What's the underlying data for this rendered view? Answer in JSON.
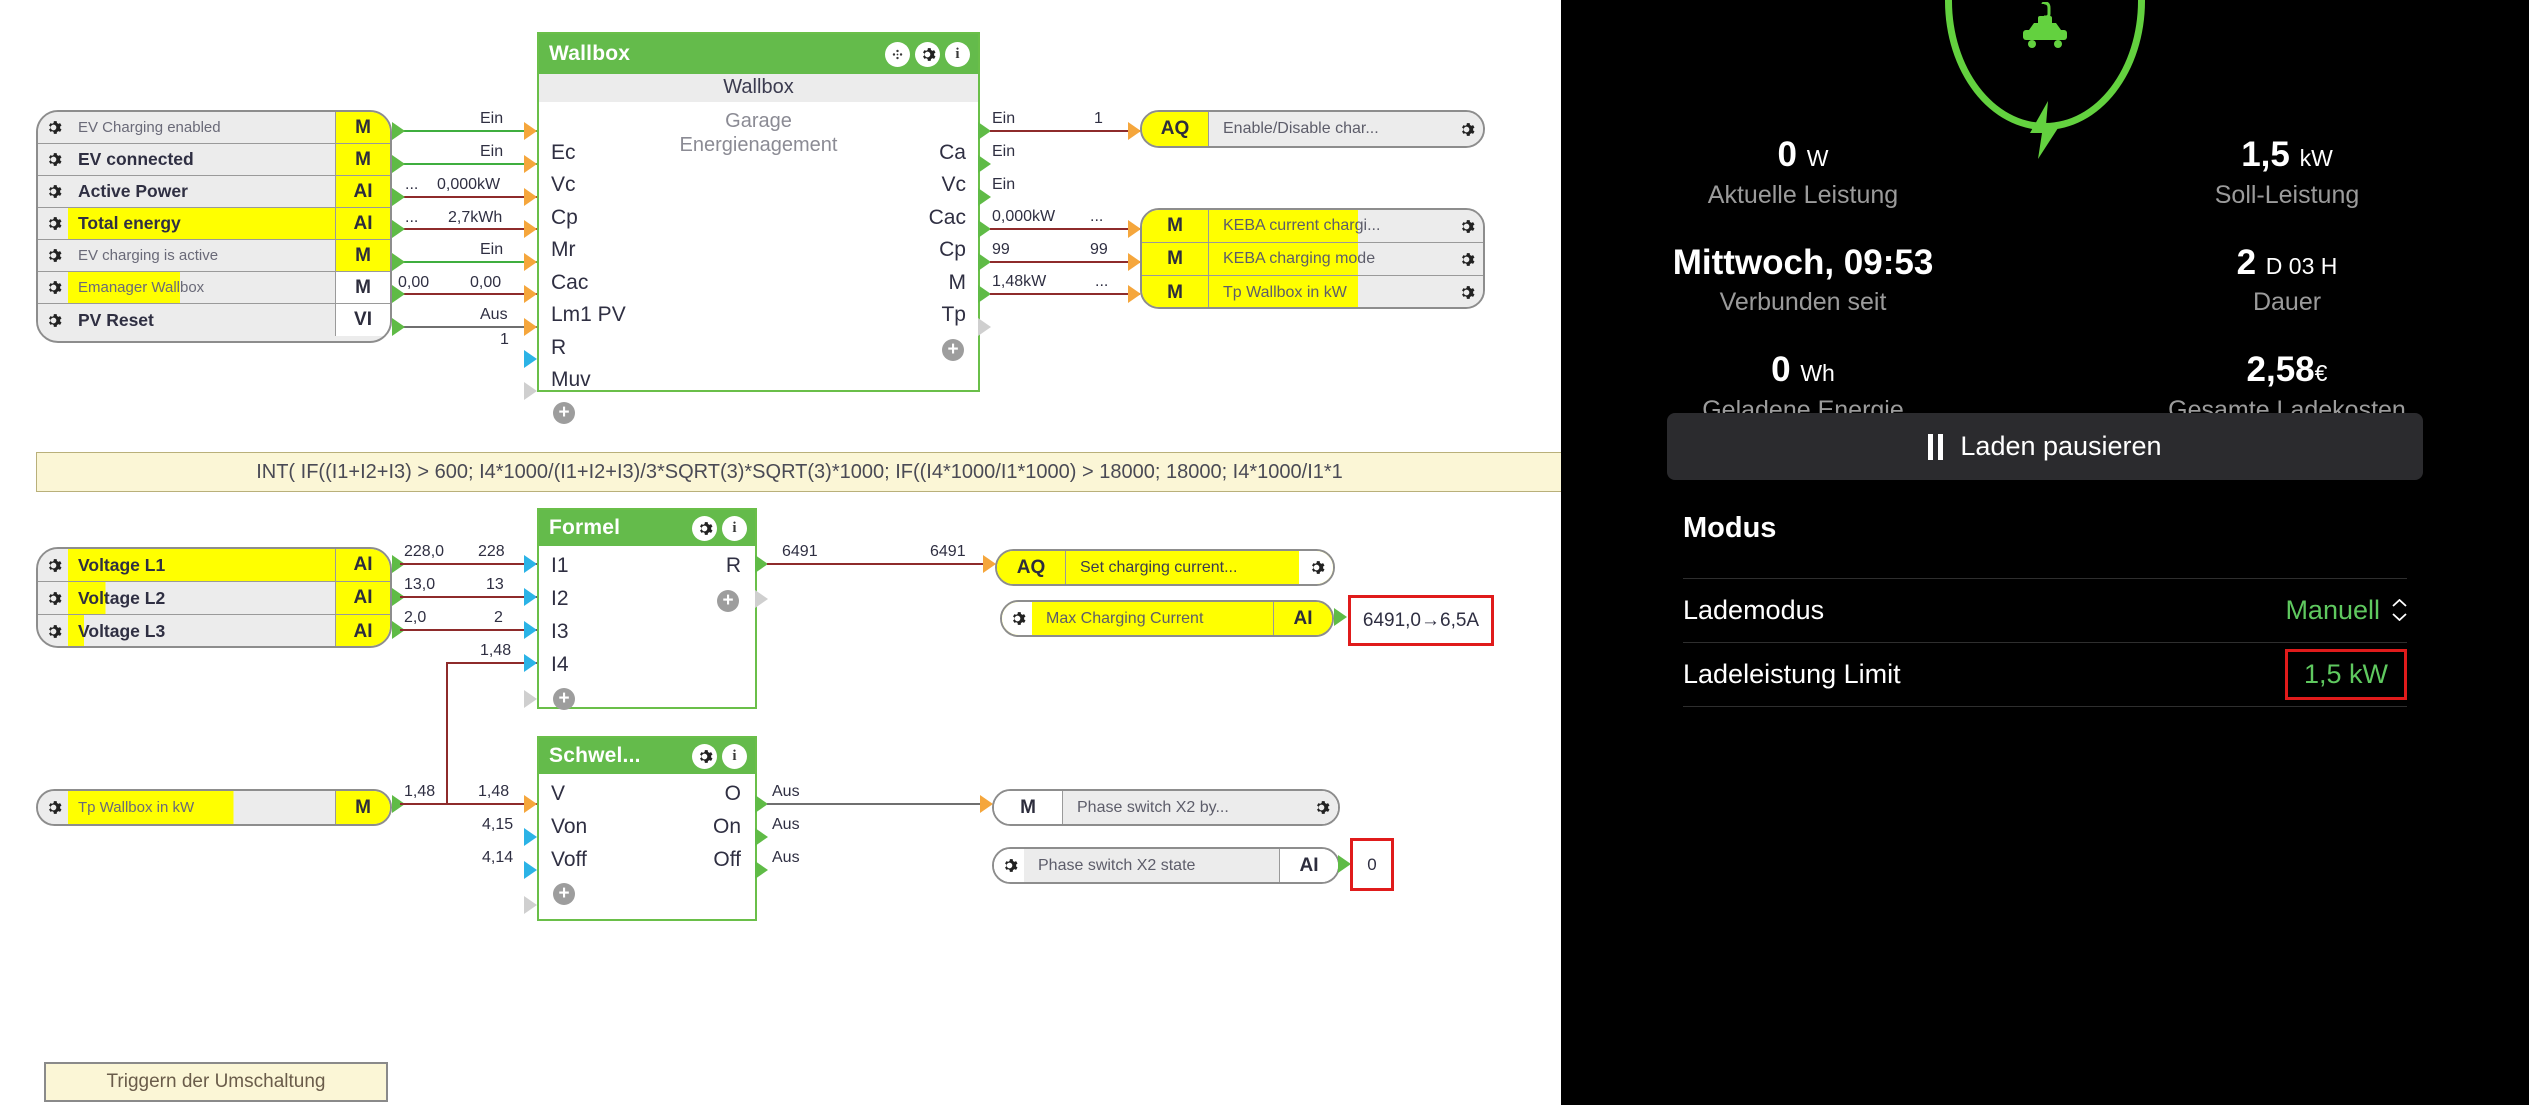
{
  "editor": {
    "source_group_1": {
      "rows": [
        {
          "label": "EV Charging enabled",
          "type": "M"
        },
        {
          "label": "EV connected",
          "type": "M"
        },
        {
          "label": "Active Power",
          "type": "AI"
        },
        {
          "label": "Total energy",
          "type": "AI"
        },
        {
          "label": "EV charging is active",
          "type": "M"
        },
        {
          "label": "Emanager Wallbox",
          "type": "M"
        },
        {
          "label": "PV Reset",
          "type": "VI"
        }
      ]
    },
    "wallbox_block": {
      "title": "Wallbox",
      "subtitle": "Wallbox",
      "line2": "Garage",
      "line3": "Energienagement",
      "inputs": [
        "Ec",
        "Vc",
        "Cp",
        "Mr",
        "Cac",
        "Lm1 PV",
        "R",
        "Muv"
      ],
      "outputs": [
        "Ca",
        "Vc",
        "Cac",
        "Cp",
        "M",
        "Tp"
      ],
      "input_wire_labels": [
        "Ein",
        "Ein",
        "0,000kW",
        "2,7kWh",
        "Ein",
        "0,00",
        "Aus",
        "1"
      ],
      "input_wire_labels_right": [
        "",
        "",
        "",
        "",
        "",
        "0,00",
        ""
      ],
      "input_dots": [
        "",
        "",
        "...",
        "...",
        "",
        "",
        ""
      ],
      "output_wire_labels": [
        "Ein",
        "Ein",
        "Ein",
        "0,000kW",
        "99",
        "1,48kW"
      ],
      "output_wire_labels_right": [
        "1",
        "",
        "",
        "...",
        "99",
        "..."
      ]
    },
    "target_group_1": {
      "rows": [
        {
          "type": "AQ",
          "label": "Enable/Disable char..."
        }
      ]
    },
    "target_group_2": {
      "rows": [
        {
          "type": "M",
          "label": "KEBA current chargi..."
        },
        {
          "type": "M",
          "label": "KEBA charging mode"
        },
        {
          "type": "M",
          "label": "Tp Wallbox in kW"
        }
      ]
    },
    "formula_bar": {
      "text": "INT(  IF((I1+I2+I3) >  600;  I4*1000/(I1+I2+I3)/3*SQRT(3)*SQRT(3)*1000;  IF((I4*1000/I1*1000)  >  18000;  18000;  I4*1000/I1*1"
    },
    "voltage_group": {
      "rows": [
        {
          "label": "Voltage L1",
          "type": "AI"
        },
        {
          "label": "Voltage L2",
          "type": "AI"
        },
        {
          "label": "Voltage L3",
          "type": "AI"
        }
      ],
      "wire_left": [
        "228,0",
        "13,0",
        "2,0"
      ],
      "wire_right": [
        "228",
        "13",
        "2"
      ]
    },
    "formel_block": {
      "title": "Formel",
      "inputs": [
        "I1",
        "I2",
        "I3",
        "I4"
      ],
      "outputs": [
        "R"
      ],
      "i4_label": "1,48",
      "out_label_left": "6491",
      "out_label_right": "6491"
    },
    "set_charging_target": {
      "type": "AQ",
      "label": "Set charging current..."
    },
    "max_charging_source": {
      "label": "Max Charging Current",
      "type": "AI",
      "value_box": "6491,0→6,5A"
    },
    "tp_wallbox_source": {
      "label": "Tp Wallbox in kW",
      "type": "M",
      "wire_left": "1,48",
      "wire_right": "1,48"
    },
    "schwell_block": {
      "title": "Schwel...",
      "inputs": [
        "V",
        "Von",
        "Voff"
      ],
      "outputs": [
        "O",
        "On",
        "Off"
      ],
      "input_values": [
        "1,48",
        "4,15",
        "4,14"
      ],
      "output_values": [
        "Aus",
        "Aus",
        "Aus"
      ]
    },
    "phase_switch_target": {
      "type": "M",
      "label": "Phase switch X2 by..."
    },
    "phase_switch_state": {
      "label": "Phase switch X2 state",
      "type": "AI",
      "value_box": "0"
    },
    "trigger_button": {
      "label": "Triggern der Umschaltung"
    }
  },
  "panel": {
    "stats": [
      {
        "value": "0",
        "unit": "W",
        "label": "Aktuelle Leistung"
      },
      {
        "value": "1,5",
        "unit": "kW",
        "label": "Soll-Leistung"
      },
      {
        "value": "Mittwoch, 09:53",
        "unit": "",
        "label": "Verbunden seit"
      },
      {
        "value": "2",
        "unit": "D 03 H",
        "label": "Dauer"
      },
      {
        "value": "0",
        "unit": "Wh",
        "label": "Geladene Energie"
      },
      {
        "value": "2,58",
        "unit": "€",
        "label": "Gesamte Ladekosten"
      }
    ],
    "pause_button": "Laden pausieren",
    "section_title": "Modus",
    "settings": [
      {
        "label": "Lademodus",
        "value": "Manuell"
      },
      {
        "label": "Ladeleistung Limit",
        "value": "1,5 kW"
      }
    ],
    "accent_green": "#63d13f",
    "highlight_red": "#e01b1b"
  }
}
